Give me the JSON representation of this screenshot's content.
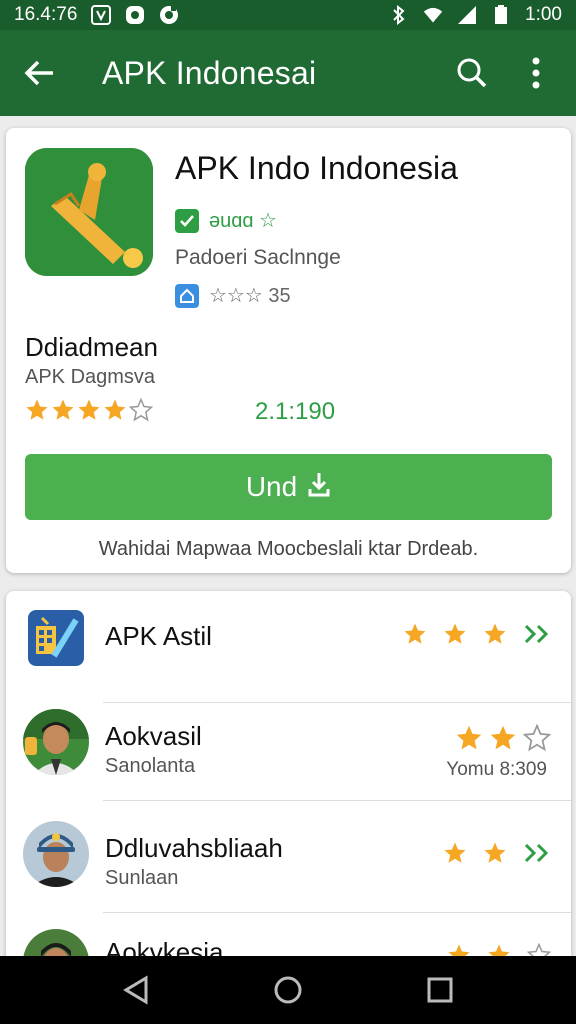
{
  "status_bar": {
    "time_left": "16.4:76",
    "time_right": "1:00",
    "icons_left": [
      "v-badge-icon",
      "notification-icon",
      "notification-icon"
    ],
    "icons_right": [
      "bluetooth-icon",
      "wifi-icon",
      "signal-icon",
      "battery-icon"
    ]
  },
  "app_bar": {
    "title": "APK Indonesai",
    "back_icon": "back-arrow-icon",
    "search_icon": "search-icon",
    "more_icon": "more-vert-icon"
  },
  "app_card": {
    "name": "APK Indo Indonesia",
    "verified_text": "ǝuɑɑ ☆",
    "developer": "Padoeri Saclnnge",
    "meta_text": "☆☆☆ 35",
    "section_title": "Ddiadmean",
    "section_sub": "APK Dagmsva",
    "rating_stars": 4,
    "rating_count": "2.1:190",
    "install_label": "Und",
    "footnote": "Wahidai Mapwaa Moocbeslali ktar Drdeab."
  },
  "list": [
    {
      "title": "APK Astil",
      "subtitle": "",
      "stars_filled": 3,
      "stars_total": 3,
      "note": ""
    },
    {
      "title": "Aokvasil",
      "subtitle": "Sanolanta",
      "stars_filled": 2,
      "stars_total": 3,
      "note": "Yomu 8:309"
    },
    {
      "title": "Ddluvahsbliaah",
      "subtitle": "Sunlaan",
      "stars_filled": 2,
      "stars_total": 2,
      "note": ""
    },
    {
      "title": "Aokvkesia",
      "subtitle": "",
      "stars_filled": 2,
      "stars_total": 3,
      "note": ""
    }
  ],
  "colors": {
    "status_bar": "#1a5d2d",
    "app_bar": "#1f6b33",
    "accent_green": "#4caf50",
    "star": "#f5a623",
    "chevron": "#2e9e44"
  }
}
